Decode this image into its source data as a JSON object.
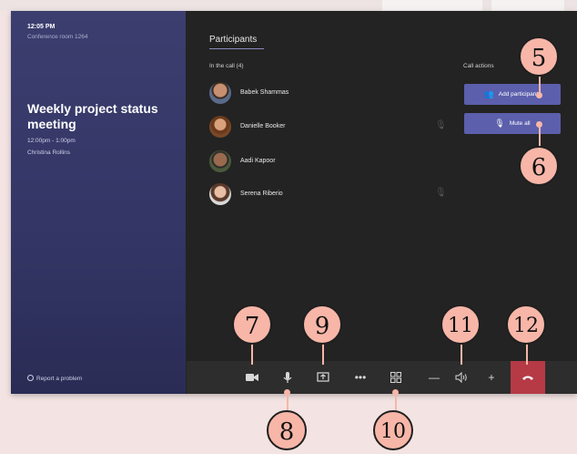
{
  "colors": {
    "accent": "#5c5fac",
    "hangup": "#b53a45",
    "callout": "#f7b6a8",
    "panel": "#3b3e6e"
  },
  "device": {
    "time": "12:05 PM",
    "room": "Conference room 1264"
  },
  "meeting": {
    "title": "Weekly project status meeting",
    "time": "12:00pm - 1:00pm",
    "organizer": "Christina Rollins"
  },
  "footer": {
    "report": "Report a problem"
  },
  "participants_panel": {
    "title": "Participants",
    "in_call": "In the call (4)",
    "call_actions": "Call actions",
    "people": [
      {
        "name": "Babek Shammas",
        "muted": false
      },
      {
        "name": "Danielle Booker",
        "muted": true
      },
      {
        "name": "Aadi Kapoor",
        "muted": false
      },
      {
        "name": "Serena Riberio",
        "muted": true
      }
    ],
    "add_label": "Add participants",
    "mute_all_label": "Mute all"
  },
  "toolbar": {
    "icons": [
      "camera-icon",
      "microphone-icon",
      "share-icon",
      "more-icon",
      "layout-icon",
      "volume-down-icon",
      "volume-icon",
      "volume-up-icon",
      "hang-up-icon"
    ]
  },
  "callouts": [
    "5",
    "6",
    "7",
    "8",
    "9",
    "10",
    "11",
    "12"
  ]
}
